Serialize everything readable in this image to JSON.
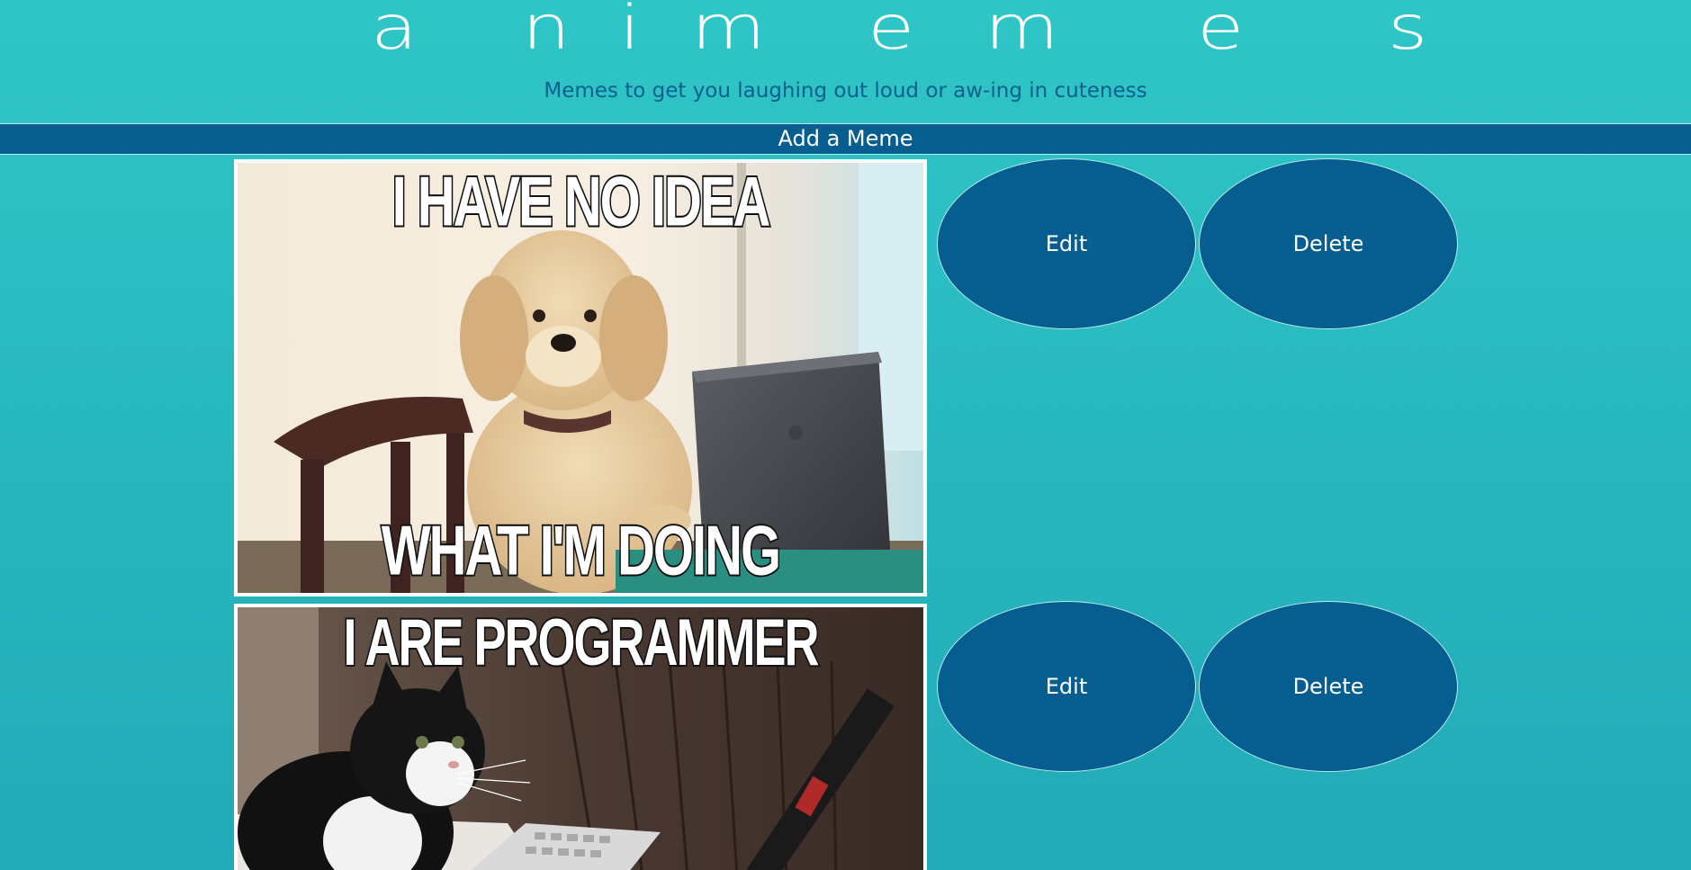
{
  "header": {
    "title_letters": [
      "a",
      "n",
      "i",
      "m",
      "e",
      "m",
      "e",
      "s"
    ],
    "tagline": "Memes to get you laughing out loud or aw-ing in cuteness"
  },
  "add_meme_label": "Add a Meme",
  "memes": [
    {
      "caption_top": "I HAVE NO IDEA",
      "caption_bottom": "WHAT I'M DOING",
      "subject": "dog at laptop",
      "edit_label": "Edit",
      "delete_label": "Delete"
    },
    {
      "caption_top": "I ARE PROGRAMMER",
      "subject": "cat at keyboard",
      "edit_label": "Edit",
      "delete_label": "Delete"
    }
  ],
  "colors": {
    "background_top": "#2fc6c6",
    "background_bottom": "#22aab7",
    "accent": "#055d90",
    "tagline": "#0d5f8f",
    "border": "#ffffff"
  }
}
